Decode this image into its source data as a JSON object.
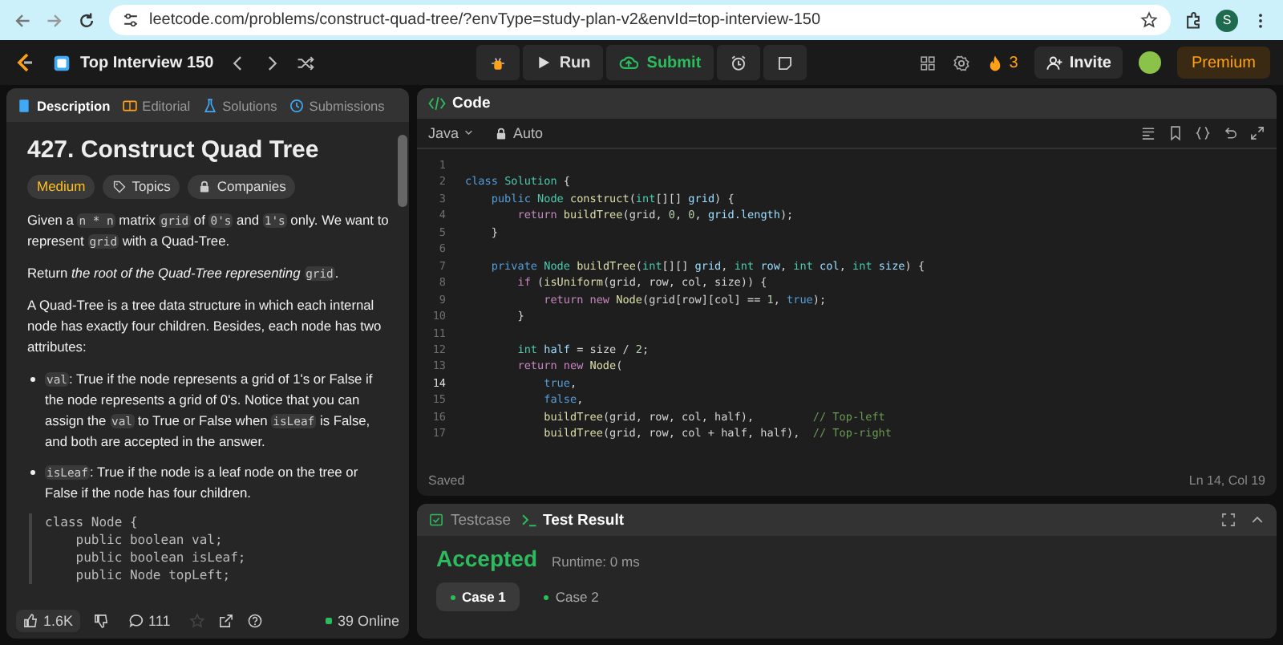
{
  "browser": {
    "url": "leetcode.com/problems/construct-quad-tree/?envType=study-plan-v2&envId=top-interview-150",
    "profile": "S"
  },
  "nav": {
    "problem_list": "Top Interview 150",
    "run": "Run",
    "submit": "Submit",
    "streak": "3",
    "invite": "Invite",
    "premium": "Premium"
  },
  "description": {
    "tabs": [
      {
        "label": "Description",
        "selected": true
      },
      {
        "label": "Editorial",
        "selected": false
      },
      {
        "label": "Solutions",
        "selected": false
      },
      {
        "label": "Submissions",
        "selected": false
      }
    ],
    "title": "427. Construct Quad Tree",
    "difficulty": "Medium",
    "tags": [
      "Topics",
      "Companies"
    ],
    "paragraphs": [
      {
        "kind": "para",
        "segments": [
          {
            "kind": "text",
            "text": "Given a "
          },
          {
            "kind": "code",
            "text": "n * n"
          },
          {
            "kind": "text",
            "text": " matrix "
          },
          {
            "kind": "code",
            "text": "grid"
          },
          {
            "kind": "text",
            "text": " of "
          },
          {
            "kind": "code",
            "text": "0's"
          },
          {
            "kind": "text",
            "text": " and "
          },
          {
            "kind": "code",
            "text": "1's"
          },
          {
            "kind": "text",
            "text": " only. We want to represent "
          },
          {
            "kind": "code",
            "text": "grid"
          },
          {
            "kind": "text",
            "text": " with a Quad-Tree."
          }
        ]
      },
      {
        "kind": "para",
        "segments": [
          {
            "kind": "text",
            "text": "Return "
          },
          {
            "kind": "em",
            "text": "the root of the Quad-Tree representing "
          },
          {
            "kind": "code",
            "text": "grid"
          },
          {
            "kind": "text",
            "text": "."
          }
        ]
      },
      {
        "kind": "para",
        "segments": [
          {
            "kind": "text",
            "text": "A Quad-Tree is a tree data structure in which each internal node has exactly four children. Besides, each node has two attributes:"
          }
        ]
      },
      {
        "kind": "bullet",
        "segments": [
          {
            "kind": "code",
            "text": "val"
          },
          {
            "kind": "text",
            "text": ": True if the node represents a grid of 1's or False if the node represents a grid of 0's. Notice that you can assign the "
          },
          {
            "kind": "code",
            "text": "val"
          },
          {
            "kind": "text",
            "text": " to True or False when "
          },
          {
            "kind": "code",
            "text": "isLeaf"
          },
          {
            "kind": "text",
            "text": " is False, and both are accepted in the answer."
          }
        ]
      },
      {
        "kind": "bullet",
        "segments": [
          {
            "kind": "code",
            "text": "isLeaf"
          },
          {
            "kind": "text",
            "text": ": True if the node is a leaf node on the tree or False if the node has four children."
          }
        ]
      }
    ],
    "code_block": [
      "class Node {",
      "    public boolean val;",
      "    public boolean isLeaf;",
      "    public Node topLeft;"
    ],
    "footer": {
      "likes": "1.6K",
      "comments": "111",
      "online": "39 Online"
    }
  },
  "editor": {
    "title": "Code",
    "language": "Java",
    "mode": "Auto",
    "lines": [
      {
        "number": "1",
        "selected": false
      },
      {
        "number": "2",
        "selected": false,
        "tokens": [
          {
            "text": "class ",
            "kind": "kw"
          },
          {
            "text": "Solution",
            "kind": "type"
          },
          {
            "text": " {",
            "kind": "plain"
          }
        ]
      },
      {
        "number": "3",
        "selected": false,
        "tokens": [
          {
            "text": "    public ",
            "kind": "kw"
          },
          {
            "text": "Node ",
            "kind": "type"
          },
          {
            "text": "construct",
            "kind": "fn"
          },
          {
            "text": "(",
            "kind": "plain"
          },
          {
            "text": "int",
            "kind": "type"
          },
          {
            "text": "[][] ",
            "kind": "plain"
          },
          {
            "text": "grid",
            "kind": "var"
          },
          {
            "text": ") {",
            "kind": "plain"
          }
        ]
      },
      {
        "number": "4",
        "selected": false,
        "tokens": [
          {
            "text": "        return ",
            "kind": "ctrl"
          },
          {
            "text": "buildTree",
            "kind": "fn"
          },
          {
            "text": "(grid, ",
            "kind": "plain"
          },
          {
            "text": "0",
            "kind": "num"
          },
          {
            "text": ", ",
            "kind": "plain"
          },
          {
            "text": "0",
            "kind": "num"
          },
          {
            "text": ", ",
            "kind": "plain"
          },
          {
            "text": "grid.length",
            "kind": "var"
          },
          {
            "text": ");",
            "kind": "plain"
          }
        ]
      },
      {
        "number": "5",
        "selected": false,
        "tokens": [
          {
            "text": "    }",
            "kind": "plain"
          }
        ]
      },
      {
        "number": "6",
        "selected": false
      },
      {
        "number": "7",
        "selected": false,
        "tokens": [
          {
            "text": "    private ",
            "kind": "kw"
          },
          {
            "text": "Node ",
            "kind": "type"
          },
          {
            "text": "buildTree",
            "kind": "fn"
          },
          {
            "text": "(",
            "kind": "plain"
          },
          {
            "text": "int",
            "kind": "type"
          },
          {
            "text": "[][] ",
            "kind": "plain"
          },
          {
            "text": "grid",
            "kind": "var"
          },
          {
            "text": ", ",
            "kind": "plain"
          },
          {
            "text": "int ",
            "kind": "type"
          },
          {
            "text": "row",
            "kind": "var"
          },
          {
            "text": ", ",
            "kind": "plain"
          },
          {
            "text": "int ",
            "kind": "type"
          },
          {
            "text": "col",
            "kind": "var"
          },
          {
            "text": ", ",
            "kind": "plain"
          },
          {
            "text": "int ",
            "kind": "type"
          },
          {
            "text": "size",
            "kind": "var"
          },
          {
            "text": ") {",
            "kind": "plain"
          }
        ]
      },
      {
        "number": "8",
        "selected": false,
        "tokens": [
          {
            "text": "        if ",
            "kind": "ctrl"
          },
          {
            "text": "(",
            "kind": "plain"
          },
          {
            "text": "isUniform",
            "kind": "fn"
          },
          {
            "text": "(grid, row, col, size)) {",
            "kind": "plain"
          }
        ]
      },
      {
        "number": "9",
        "selected": false,
        "tokens": [
          {
            "text": "            return new ",
            "kind": "ctrl"
          },
          {
            "text": "Node",
            "kind": "fn"
          },
          {
            "text": "(grid[row][col] == ",
            "kind": "plain"
          },
          {
            "text": "1",
            "kind": "num"
          },
          {
            "text": ", ",
            "kind": "plain"
          },
          {
            "text": "true",
            "kind": "kw"
          },
          {
            "text": ");",
            "kind": "plain"
          }
        ]
      },
      {
        "number": "10",
        "selected": false,
        "tokens": [
          {
            "text": "        }",
            "kind": "plain"
          }
        ]
      },
      {
        "number": "11",
        "selected": false
      },
      {
        "number": "12",
        "selected": false,
        "tokens": [
          {
            "text": "        int ",
            "kind": "type"
          },
          {
            "text": "half",
            "kind": "var"
          },
          {
            "text": " = size / ",
            "kind": "plain"
          },
          {
            "text": "2",
            "kind": "num"
          },
          {
            "text": ";",
            "kind": "plain"
          }
        ]
      },
      {
        "number": "13",
        "selected": false,
        "tokens": [
          {
            "text": "        return new ",
            "kind": "ctrl"
          },
          {
            "text": "Node",
            "kind": "fn"
          },
          {
            "text": "(",
            "kind": "plain"
          }
        ]
      },
      {
        "number": "14",
        "selected": true,
        "tokens": [
          {
            "text": "            true",
            "kind": "kw"
          },
          {
            "text": ",",
            "kind": "plain"
          }
        ]
      },
      {
        "number": "15",
        "selected": false,
        "tokens": [
          {
            "text": "            false",
            "kind": "kw"
          },
          {
            "text": ",",
            "kind": "plain"
          }
        ]
      },
      {
        "number": "16",
        "selected": false,
        "tokens": [
          {
            "text": "            buildTree",
            "kind": "fn"
          },
          {
            "text": "(grid, row, col, half),         ",
            "kind": "plain"
          },
          {
            "text": "// Top-left",
            "kind": "comment"
          }
        ]
      },
      {
        "number": "17",
        "selected": false,
        "tokens": [
          {
            "text": "            buildTree",
            "kind": "fn"
          },
          {
            "text": "(grid, row, col + half, half),  ",
            "kind": "plain"
          },
          {
            "text": "// Top-right",
            "kind": "comment"
          }
        ]
      }
    ],
    "status": "Saved",
    "cursor": "Ln 14, Col 19"
  },
  "results": {
    "tabs": [
      {
        "label": "Testcase",
        "selected": false
      },
      {
        "label": "Test Result",
        "selected": true
      }
    ],
    "verdict": "Accepted",
    "runtime": "Runtime: 0 ms",
    "cases": [
      {
        "label": "Case 1",
        "selected": true
      },
      {
        "label": "Case 2",
        "selected": false
      }
    ]
  }
}
